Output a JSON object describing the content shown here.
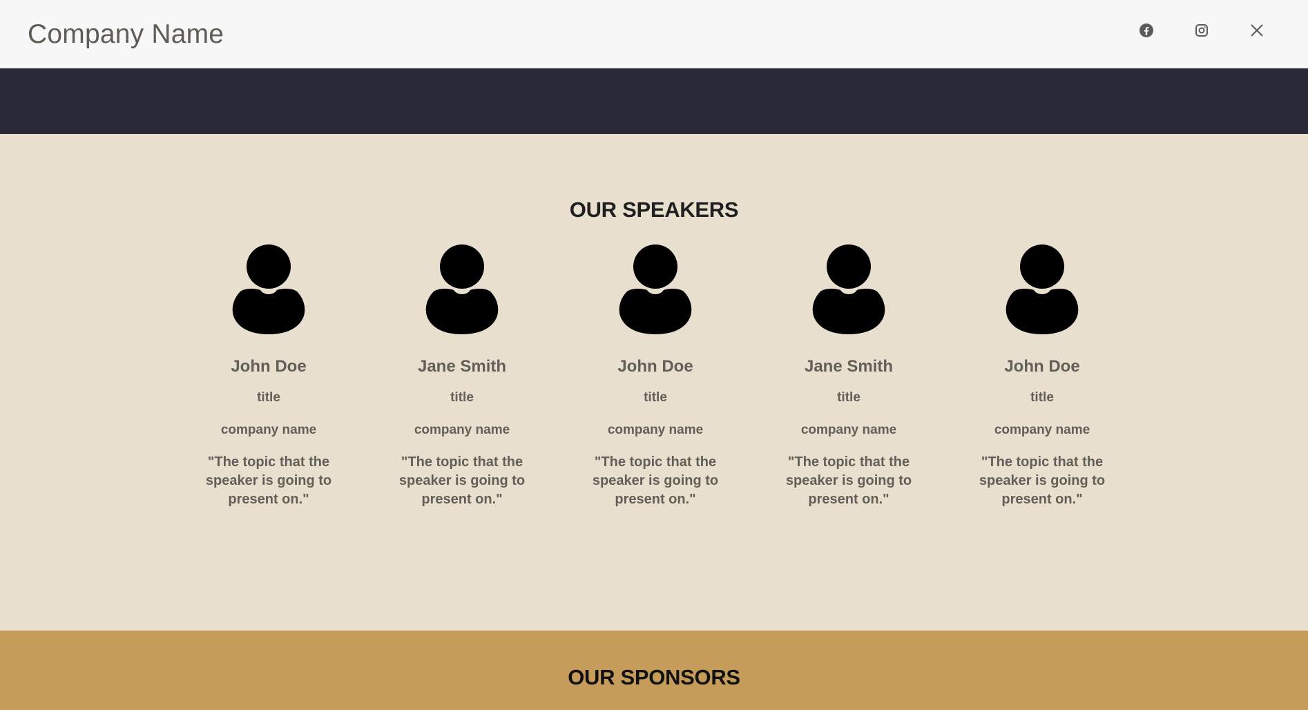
{
  "header": {
    "brand": "Company Name",
    "social": [
      {
        "name": "facebook",
        "icon": "facebook-icon"
      },
      {
        "name": "instagram",
        "icon": "instagram-icon"
      },
      {
        "name": "x",
        "icon": "x-icon"
      }
    ]
  },
  "speakers": {
    "title": "OUR SPEAKERS",
    "items": [
      {
        "name": "John Doe",
        "title": "title",
        "company": "company name",
        "topic": "\"The topic that the speaker is going to present on.\"",
        "avatar_icon": "user-icon"
      },
      {
        "name": "Jane Smith",
        "title": "title",
        "company": "company name",
        "topic": "\"The topic that the speaker is going to present on.\"",
        "avatar_icon": "user-icon"
      },
      {
        "name": "John Doe",
        "title": "title",
        "company": "company name",
        "topic": "\"The topic that the speaker is going to present on.\"",
        "avatar_icon": "user-icon"
      },
      {
        "name": "Jane Smith",
        "title": "title",
        "company": "company name",
        "topic": "\"The topic that the speaker is going to present on.\"",
        "avatar_icon": "user-icon"
      },
      {
        "name": "John Doe",
        "title": "title",
        "company": "company name",
        "topic": "\"The topic that the speaker is going to present on.\"",
        "avatar_icon": "user-icon"
      }
    ]
  },
  "sponsors": {
    "title": "OUR SPONSORS"
  },
  "colors": {
    "header_bg": "#f7f7f8",
    "hero_bg": "#292a37",
    "speakers_bg": "#e8dfcf",
    "sponsors_bg": "#c59c5a",
    "text_muted": "#625e58"
  }
}
